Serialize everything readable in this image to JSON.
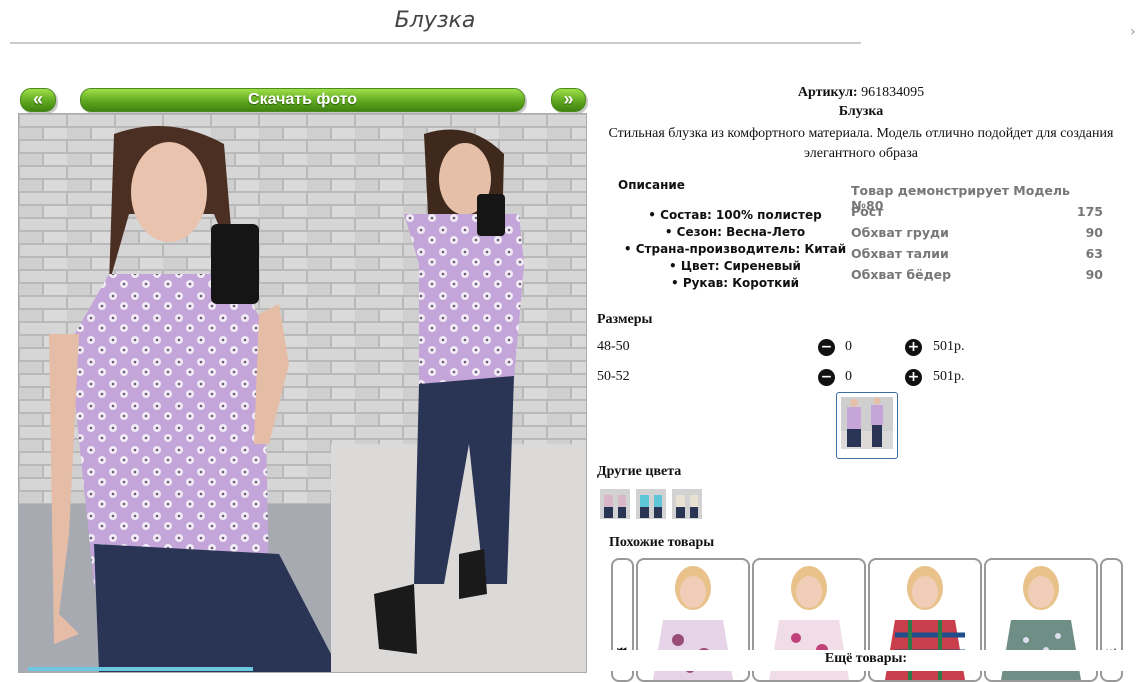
{
  "page": {
    "title": "Блузка"
  },
  "nav": {
    "prev": "«",
    "download": "Скачать фото",
    "next": "»"
  },
  "product": {
    "sku_label": "Артикул:",
    "sku_value": "961834095",
    "name": "Блузка",
    "description": "Стильная блузка из комфортного материала. Модель отлично подойдет для создания элегантного образа"
  },
  "specs": {
    "heading": "Описание",
    "items": [
      "Состав: 100% полистер",
      "Сезон: Весна-Лето",
      "Страна-производитель: Китай",
      "Цвет: Сиреневый",
      "Рукав: Короткий"
    ]
  },
  "model": {
    "heading": "Товар демонстрирует Модель №80",
    "rows": [
      {
        "label": "Рост",
        "value": "175"
      },
      {
        "label": "Обхват груди",
        "value": "90"
      },
      {
        "label": "Обхват талии",
        "value": "63"
      },
      {
        "label": "Обхват бёдер",
        "value": "90"
      }
    ]
  },
  "sizes": {
    "heading": "Размеры",
    "rows": [
      {
        "size": "48-50",
        "qty": "0",
        "price": "501р."
      },
      {
        "size": "50-52",
        "qty": "0",
        "price": "501р."
      }
    ]
  },
  "other_colors": {
    "heading": "Другие цвета",
    "swatches": [
      "#d9b7c8",
      "#5fc6d8",
      "#e8e1d2"
    ]
  },
  "similar": {
    "heading": "Похожие товары"
  },
  "more_label": "Ещё товары:",
  "colors": {
    "accent": "#5fa820",
    "blouse": "#c6a6d8",
    "jeans": "#2a3555"
  }
}
